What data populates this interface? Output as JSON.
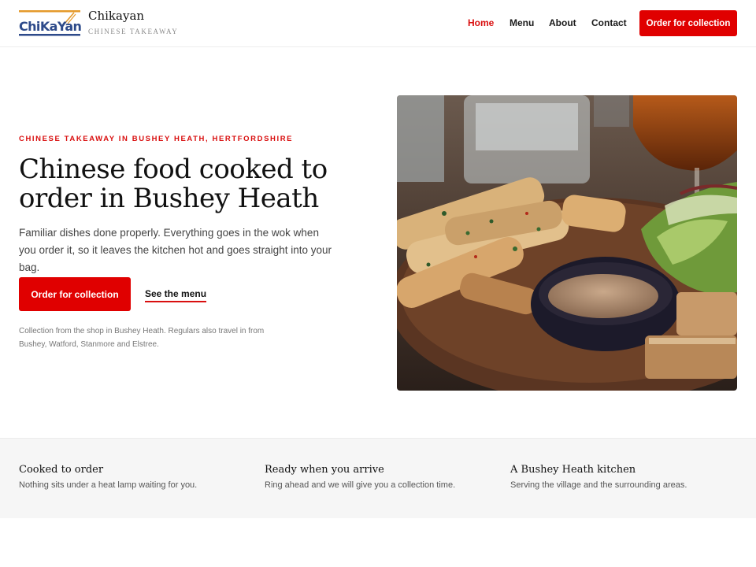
{
  "brand": {
    "logo_text": "ChiKaYan",
    "name": "Chikayan",
    "tagline": "CHINESE TAKEAWAY",
    "colors": {
      "navy": "#2d4a8a",
      "orange": "#e59a2b",
      "red": "#e00000"
    }
  },
  "nav": {
    "items": [
      {
        "label": "Home",
        "active": true
      },
      {
        "label": "Menu",
        "active": false
      },
      {
        "label": "About",
        "active": false
      },
      {
        "label": "Contact",
        "active": false
      }
    ],
    "cta_label": "Order for collection"
  },
  "hero": {
    "eyebrow": "CHINESE TAKEAWAY IN BUSHEY HEATH, HERTFORDSHIRE",
    "title": "Chinese food cooked to order in Bushey Heath",
    "text": "Familiar dishes done properly. Everything goes in the wok when you order it, so it leaves the kitchen hot and goes straight into your bag.",
    "primary_label": "Order for collection",
    "secondary_label": "See the menu",
    "note": "Collection from the shop in Bushey Heath. Regulars also travel in from Bushey, Watford, Stanmore and Elstree.",
    "image_alt": "salt and pepper squid with dipping sauce and salad"
  },
  "features": [
    {
      "title": "Cooked to order",
      "text": "Nothing sits under a heat lamp waiting for you."
    },
    {
      "title": "Ready when you arrive",
      "text": "Ring ahead and we will give you a collection time."
    },
    {
      "title": "A Bushey Heath kitchen",
      "text": "Serving the village and the surrounding areas."
    }
  ]
}
